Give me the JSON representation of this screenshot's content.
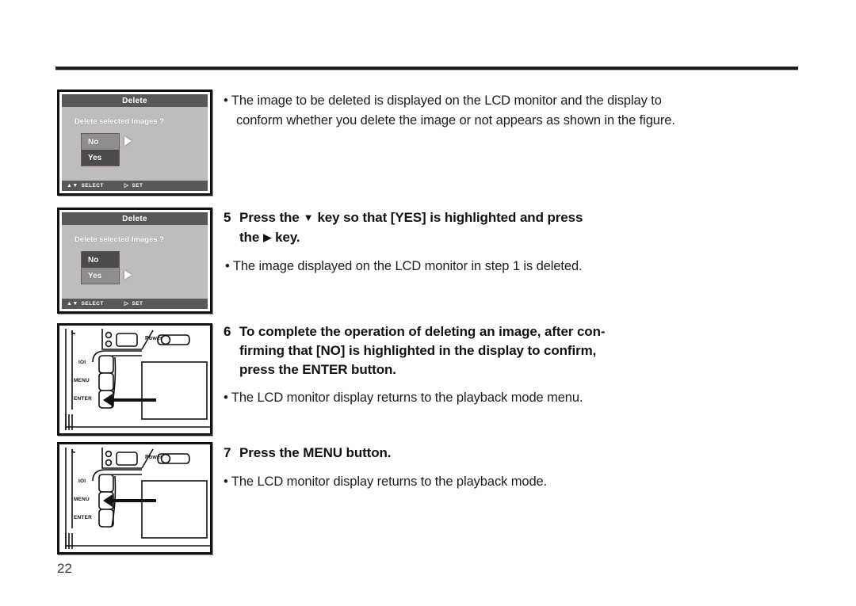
{
  "page": {
    "number": "22"
  },
  "lcd_screens": [
    {
      "id": "screen-step4",
      "title": "Delete",
      "question": "Delete selected Images ?",
      "options": [
        {
          "label": "No",
          "highlighted": true
        },
        {
          "label": "Yes",
          "highlighted": false
        }
      ],
      "cursor_on": "No",
      "footer": [
        {
          "glyph": "▲▼",
          "label": "SELECT"
        },
        {
          "glyph": "▷",
          "label": "SET"
        }
      ]
    },
    {
      "id": "screen-step5",
      "title": "Delete",
      "question": "Delete selected Images ?",
      "options": [
        {
          "label": "No",
          "highlighted": false
        },
        {
          "label": "Yes",
          "highlighted": true
        }
      ],
      "cursor_on": "Yes",
      "footer": [
        {
          "glyph": "▲▼",
          "label": "SELECT"
        },
        {
          "glyph": "▷",
          "label": "SET"
        }
      ]
    }
  ],
  "camera_figures": [
    {
      "id": "camera-step6",
      "power_label": "Power",
      "buttons": [
        "IOI",
        "MENU",
        "ENTER"
      ],
      "arrow_points_to": "ENTER"
    },
    {
      "id": "camera-step7",
      "power_label": "Power",
      "buttons": [
        "IOI",
        "MENU",
        "ENTER"
      ],
      "arrow_points_to": "MENU"
    }
  ],
  "content": {
    "intro_bullet": {
      "line1": "• The image to be deleted is displayed on the LCD monitor and the display to",
      "line2": "conform whether you delete the image or not appears as shown in the figure."
    },
    "step5": {
      "number": "5",
      "head_a": "Press the",
      "head_key1": "▼",
      "head_b": "key so that [YES] is highlighted and press",
      "head_c": "the",
      "head_key2": "▶",
      "head_d": "key.",
      "bullet": "•  The image displayed on the LCD monitor in step 1 is deleted."
    },
    "step6": {
      "number": "6",
      "head_line1": "To complete the operation of deleting an image, after con-",
      "head_line2": "firming that [NO] is highlighted in the display to confirm,",
      "head_line3": "press the ENTER button.",
      "bullet": "• The LCD monitor display returns to the playback mode menu."
    },
    "step7": {
      "number": "7",
      "head_line1": "Press the MENU button.",
      "bullet": "• The LCD monitor display returns to the playback mode."
    }
  }
}
